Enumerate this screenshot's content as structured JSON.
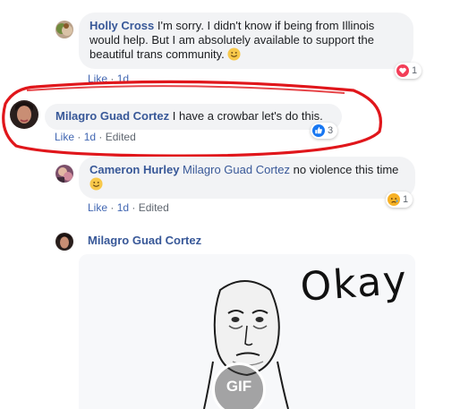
{
  "comments": [
    {
      "author": "Holly Cross",
      "text": "I'm sorry. I didn't know if being from Illinois would help. But I am absolutely available to support the beautiful trans community.",
      "meta": {
        "like": "Like",
        "sep": "·",
        "time": "1d"
      },
      "reaction": {
        "icon": "heart-reaction-icon",
        "count": "1",
        "color": "#f33e58"
      }
    },
    {
      "author": "Milagro Guad Cortez",
      "text": "I have a crowbar let's do this.",
      "meta": {
        "like": "Like",
        "sep": "·",
        "time": "1d",
        "edited": "Edited"
      },
      "reaction": {
        "icon": "like-reaction-icon",
        "count": "3",
        "color": "#1877f2"
      },
      "highlight_color": "#e0161b"
    },
    {
      "author": "Cameron Hurley",
      "mention": "Milagro Guad Cortez",
      "text": "no violence this time",
      "meta": {
        "like": "Like",
        "sep": "·",
        "time": "1d",
        "edited": "Edited"
      },
      "reaction": {
        "icon": "sad-reaction-icon",
        "count": "1",
        "color": "#f7b125"
      }
    },
    {
      "author": "Milagro Guad Cortez",
      "gif": {
        "caption": "Okay",
        "badge": "GIF",
        "icon": "okay-meme-face-icon"
      }
    }
  ]
}
